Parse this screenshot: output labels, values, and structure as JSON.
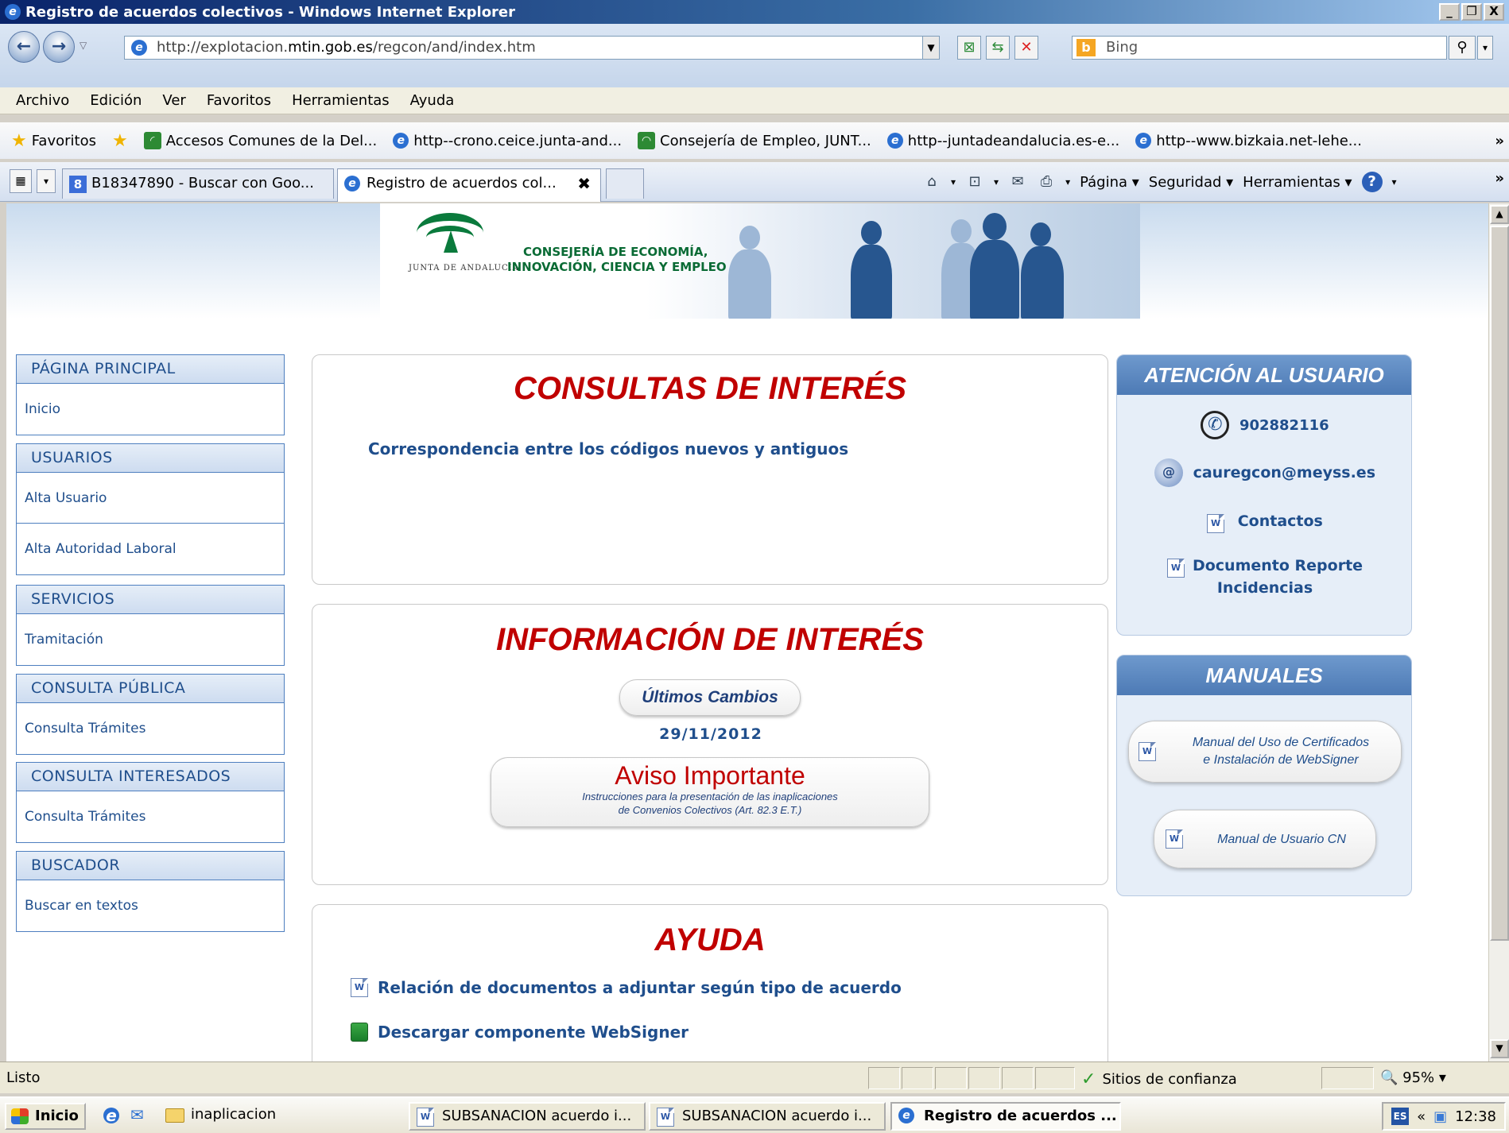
{
  "window": {
    "title": "Registro de acuerdos colectivos - Windows Internet Explorer",
    "minimize": "_",
    "maximize": "&#x1F5D7;",
    "close": "X"
  },
  "address": {
    "url_prefix": "http://explotacion.",
    "url_domain": "mtin.gob.es",
    "url_suffix": "/regcon/and/index.htm",
    "search_placeholder": "Bing"
  },
  "menu": [
    "Archivo",
    "Edición",
    "Ver",
    "Favoritos",
    "Herramientas",
    "Ayuda"
  ],
  "favorites": {
    "label": "Favoritos",
    "items": [
      "Accesos Comunes de la Del...",
      "http--crono.ceice.junta-and...",
      "Consejería de Empleo, JUNT...",
      "http--juntadeandalucia.es-e...",
      "http--www.bizkaia.net-lehe..."
    ]
  },
  "tabs": [
    {
      "label": "B18347890 - Buscar con Goo..."
    },
    {
      "label": "Registro de acuerdos col...",
      "close": "✖"
    }
  ],
  "commandbar": {
    "pagina": "Página ▾",
    "seguridad": "Seguridad ▾",
    "herramientas": "Herramientas ▾"
  },
  "banner": {
    "junta": "JUNTA DE ANDALUCIA",
    "consejeria_line1": "CONSEJERÍA DE ECONOMÍA,",
    "consejeria_line2": "INNOVACIÓN, CIENCIA Y EMPLEO"
  },
  "sidebar": [
    {
      "header": "PÁGINA PRINCIPAL",
      "items": [
        "Inicio"
      ]
    },
    {
      "header": "USUARIOS",
      "items": [
        "Alta Usuario",
        "Alta Autoridad Laboral"
      ]
    },
    {
      "header": "SERVICIOS",
      "items": [
        "Tramitación"
      ]
    },
    {
      "header": "CONSULTA PÚBLICA",
      "items": [
        "Consulta Trámites"
      ]
    },
    {
      "header": "CONSULTA INTERESADOS",
      "items": [
        "Consulta Trámites"
      ]
    },
    {
      "header": "BUSCADOR",
      "items": [
        "Buscar en textos"
      ]
    }
  ],
  "consultas": {
    "title": "CONSULTAS DE INTERÉS",
    "link": "Correspondencia entre los códigos nuevos y antiguos"
  },
  "informacion": {
    "title": "INFORMACIÓN DE INTERÉS",
    "ultimos_cambios": "Últimos Cambios",
    "date": "29/11/2012",
    "aviso_title": "Aviso Importante",
    "aviso_line1": "Instrucciones para la presentación de las inaplicaciones",
    "aviso_line2": "de Convenios Colectivos (Art. 82.3 E.T.)"
  },
  "ayuda": {
    "title": "AYUDA",
    "link1": "Relación de documentos a adjuntar según tipo de acuerdo",
    "link2": "Descargar componente WebSigner"
  },
  "atencion": {
    "title": "ATENCIÓN AL USUARIO",
    "phone": "902882116",
    "email": "cauregcon@meyss.es",
    "contactos": "Contactos",
    "documento_line1": "Documento Reporte",
    "documento_line2": "Incidencias"
  },
  "manuales": {
    "title": "MANUALES",
    "manual1_line1": "Manual del Uso de Certificados",
    "manual1_line2": "e Instalación de WebSigner",
    "manual2": "Manual de Usuario CN"
  },
  "status": {
    "text": "Listo",
    "zone": "Sitios de confianza",
    "zoom": "95%"
  },
  "taskbar": {
    "start": "Inicio",
    "folder": "inaplicacion",
    "btn1": "SUBSANACION acuerdo i...",
    "btn2": "SUBSANACION acuerdo i...",
    "btn3": "Registro de acuerdos ...",
    "lang": "ES",
    "clock": "12:38"
  },
  "colors": {
    "title_red": "#c00000",
    "link_blue": "#1f4e8c",
    "panel_blue": "#4d7ab5"
  }
}
